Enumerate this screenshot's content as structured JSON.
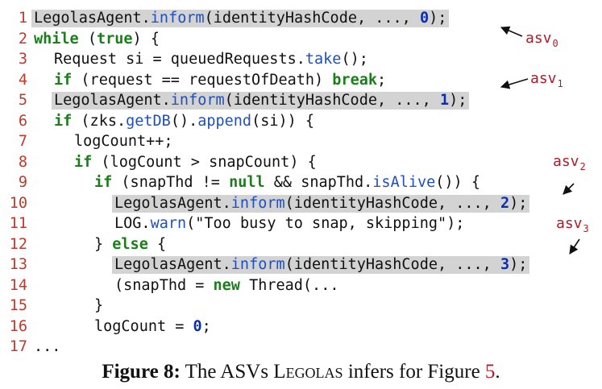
{
  "code": {
    "lines": [
      {
        "n": "1",
        "indent": 0,
        "highlight": true,
        "parts": [
          {
            "t": "LegolasAgent."
          },
          {
            "t": "inform",
            "c": "fn"
          },
          {
            "t": "(identityHashCode, ..., "
          },
          {
            "t": "0",
            "c": "num"
          },
          {
            "t": ");"
          }
        ]
      },
      {
        "n": "2",
        "indent": 0,
        "highlight": false,
        "parts": [
          {
            "t": "while",
            "c": "kw"
          },
          {
            "t": " ("
          },
          {
            "t": "true",
            "c": "kw"
          },
          {
            "t": ") {"
          }
        ]
      },
      {
        "n": "3",
        "indent": 1,
        "highlight": false,
        "parts": [
          {
            "t": "Request si = queuedRequests."
          },
          {
            "t": "take",
            "c": "fn"
          },
          {
            "t": "();"
          }
        ]
      },
      {
        "n": "4",
        "indent": 1,
        "highlight": false,
        "parts": [
          {
            "t": "if",
            "c": "kw"
          },
          {
            "t": " (request == requestOfDeath) "
          },
          {
            "t": "break",
            "c": "kw"
          },
          {
            "t": ";"
          }
        ]
      },
      {
        "n": "5",
        "indent": 1,
        "highlight": true,
        "parts": [
          {
            "t": "LegolasAgent."
          },
          {
            "t": "inform",
            "c": "fn"
          },
          {
            "t": "(identityHashCode, ..., "
          },
          {
            "t": "1",
            "c": "num"
          },
          {
            "t": ");"
          }
        ]
      },
      {
        "n": "6",
        "indent": 1,
        "highlight": false,
        "parts": [
          {
            "t": "if",
            "c": "kw"
          },
          {
            "t": " (zks."
          },
          {
            "t": "getDB",
            "c": "fn"
          },
          {
            "t": "()."
          },
          {
            "t": "append",
            "c": "fn"
          },
          {
            "t": "(si)) {"
          }
        ]
      },
      {
        "n": "7",
        "indent": 2,
        "highlight": false,
        "parts": [
          {
            "t": "logCount++;"
          }
        ]
      },
      {
        "n": "8",
        "indent": 2,
        "highlight": false,
        "parts": [
          {
            "t": "if",
            "c": "kw"
          },
          {
            "t": " (logCount > snapCount) {"
          }
        ]
      },
      {
        "n": "9",
        "indent": 3,
        "highlight": false,
        "parts": [
          {
            "t": "if",
            "c": "kw"
          },
          {
            "t": " (snapThd != "
          },
          {
            "t": "null",
            "c": "kw"
          },
          {
            "t": " && snapThd."
          },
          {
            "t": "isAlive",
            "c": "fn"
          },
          {
            "t": "()) {"
          }
        ]
      },
      {
        "n": "10",
        "indent": 4,
        "highlight": true,
        "parts": [
          {
            "t": "LegolasAgent."
          },
          {
            "t": "inform",
            "c": "fn"
          },
          {
            "t": "(identityHashCode, ..., "
          },
          {
            "t": "2",
            "c": "num"
          },
          {
            "t": ");"
          }
        ]
      },
      {
        "n": "11",
        "indent": 4,
        "highlight": false,
        "parts": [
          {
            "t": "LOG."
          },
          {
            "t": "warn",
            "c": "fn"
          },
          {
            "t": "(\"Too busy to snap, skipping\");"
          }
        ]
      },
      {
        "n": "12",
        "indent": 3,
        "highlight": false,
        "parts": [
          {
            "t": "} "
          },
          {
            "t": "else",
            "c": "kw"
          },
          {
            "t": " {"
          }
        ]
      },
      {
        "n": "13",
        "indent": 4,
        "highlight": true,
        "parts": [
          {
            "t": "LegolasAgent."
          },
          {
            "t": "inform",
            "c": "fn"
          },
          {
            "t": "(identityHashCode, ..., "
          },
          {
            "t": "3",
            "c": "num"
          },
          {
            "t": ");"
          }
        ]
      },
      {
        "n": "14",
        "indent": 4,
        "highlight": false,
        "parts": [
          {
            "t": "(snapThd = "
          },
          {
            "t": "new",
            "c": "kw"
          },
          {
            "t": " Thread(..."
          }
        ]
      },
      {
        "n": "15",
        "indent": 3,
        "highlight": false,
        "parts": [
          {
            "t": "}"
          }
        ]
      },
      {
        "n": "16",
        "indent": 3,
        "highlight": false,
        "parts": [
          {
            "t": "logCount = "
          },
          {
            "t": "0",
            "c": "num"
          },
          {
            "t": ";"
          }
        ]
      },
      {
        "n": "17",
        "indent": 0,
        "highlight": false,
        "parts": [
          {
            "t": "..."
          }
        ]
      }
    ]
  },
  "annotations": [
    {
      "label": "asv",
      "sub": "0"
    },
    {
      "label": "asv",
      "sub": "1"
    },
    {
      "label": "asv",
      "sub": "2"
    },
    {
      "label": "asv",
      "sub": "3"
    }
  ],
  "caption": {
    "label": "Figure 8:",
    "text_before": " The ASVs ",
    "system": "Legolas",
    "text_after": " infers for Figure ",
    "ref": "5",
    "end": "."
  }
}
